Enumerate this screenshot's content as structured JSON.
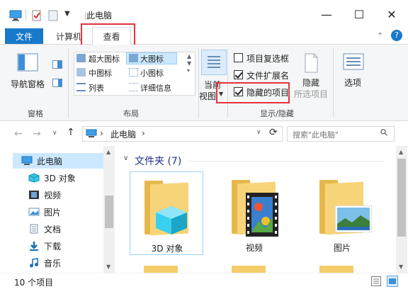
{
  "window": {
    "title": "此电脑",
    "minimize_glyph": "—",
    "maximize_glyph": "☐",
    "close_glyph": "✕"
  },
  "tabs": {
    "file": "文件",
    "computer": "计算机",
    "view": "查看",
    "collapse_glyph": "⌃",
    "help_glyph": "?"
  },
  "ribbon": {
    "panes": {
      "nav_pane": "导航窗格",
      "group_label": "窗格"
    },
    "layout": {
      "extra_large": "超大图标",
      "large": "大图标",
      "medium": "中图标",
      "small": "小图标",
      "list": "列表",
      "details": "详细信息",
      "group_label": "布局"
    },
    "current_view": {
      "line1": "当前",
      "line2": "视图"
    },
    "show_hide": {
      "item_checkboxes": {
        "label": "项目复选框",
        "checked": false
      },
      "file_extensions": {
        "label": "文件扩展名",
        "checked": true
      },
      "hidden_items": {
        "label": "隐藏的项目",
        "checked": true
      },
      "hide_selected_line1": "隐藏",
      "hide_selected_line2": "所选项目",
      "group_label": "显示/隐藏"
    },
    "options": "选项"
  },
  "navbar": {
    "back_glyph": "←",
    "forward_glyph": "→",
    "dropdown_glyph": "∨",
    "up_glyph": "↑",
    "path": "此电脑",
    "path_sep": "›",
    "addr_dropdown": "∨",
    "refresh_glyph": "⟳",
    "search_placeholder": "搜索\"此电脑\"",
    "search_glyph": "⚲"
  },
  "sidebar": {
    "items": [
      {
        "label": "此电脑",
        "icon": "computer-icon"
      },
      {
        "label": "3D 对象",
        "icon": "cube-icon"
      },
      {
        "label": "视频",
        "icon": "film-icon"
      },
      {
        "label": "图片",
        "icon": "picture-icon"
      },
      {
        "label": "文档",
        "icon": "document-icon"
      },
      {
        "label": "下载",
        "icon": "download-icon"
      },
      {
        "label": "音乐",
        "icon": "music-icon"
      }
    ]
  },
  "content": {
    "group_title": "文件夹 (7)",
    "folders": [
      {
        "label": "3D 对象"
      },
      {
        "label": "视频"
      },
      {
        "label": "图片"
      }
    ]
  },
  "status": {
    "count": "10 个项目"
  },
  "colors": {
    "accent": "#1979ca",
    "highlight_red": "#e4343c",
    "folder_yellow": "#f8d479",
    "selection_blue": "#cce8ff"
  }
}
